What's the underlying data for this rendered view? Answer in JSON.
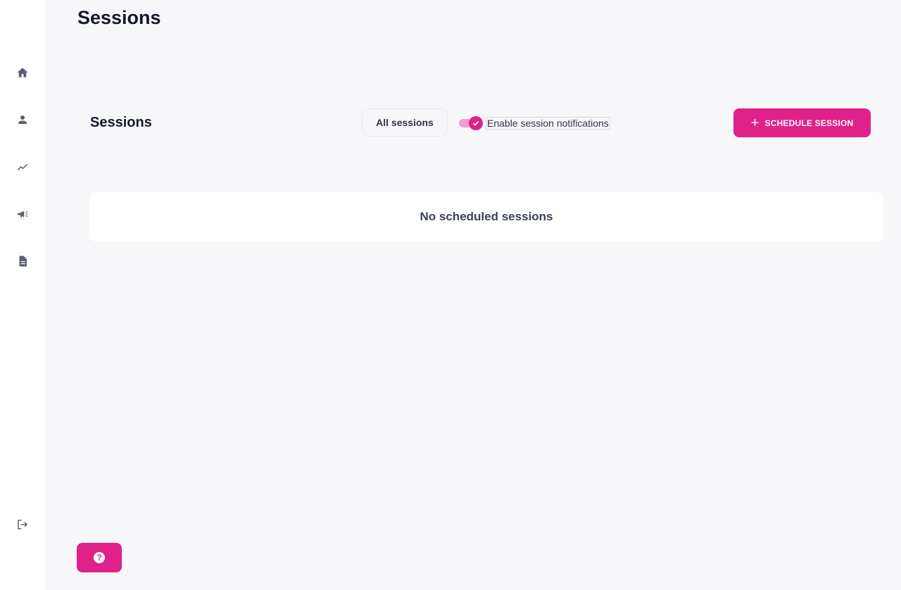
{
  "page": {
    "title": "Sessions"
  },
  "sidebar": {
    "items": [
      {
        "name": "home",
        "icon": "home-icon"
      },
      {
        "name": "profile",
        "icon": "person-icon"
      },
      {
        "name": "analytics",
        "icon": "trend-line-icon"
      },
      {
        "name": "announcements",
        "icon": "megaphone-icon"
      },
      {
        "name": "documents",
        "icon": "document-icon"
      }
    ],
    "logout_icon": "logout-icon"
  },
  "sessions": {
    "heading": "Sessions",
    "filter_label": "All sessions",
    "notifications_label": "Enable session notifications",
    "notifications_enabled": true,
    "schedule_button_label": "SCHEDULE SESSION",
    "empty_message": "No scheduled sessions"
  },
  "help": {
    "icon_glyph": "?"
  },
  "colors": {
    "accent": "#e0218a",
    "accent_light": "#f49ad0",
    "background": "#f7f7fa",
    "sidebar_icon": "#5a6072",
    "title_text": "#14192b"
  }
}
